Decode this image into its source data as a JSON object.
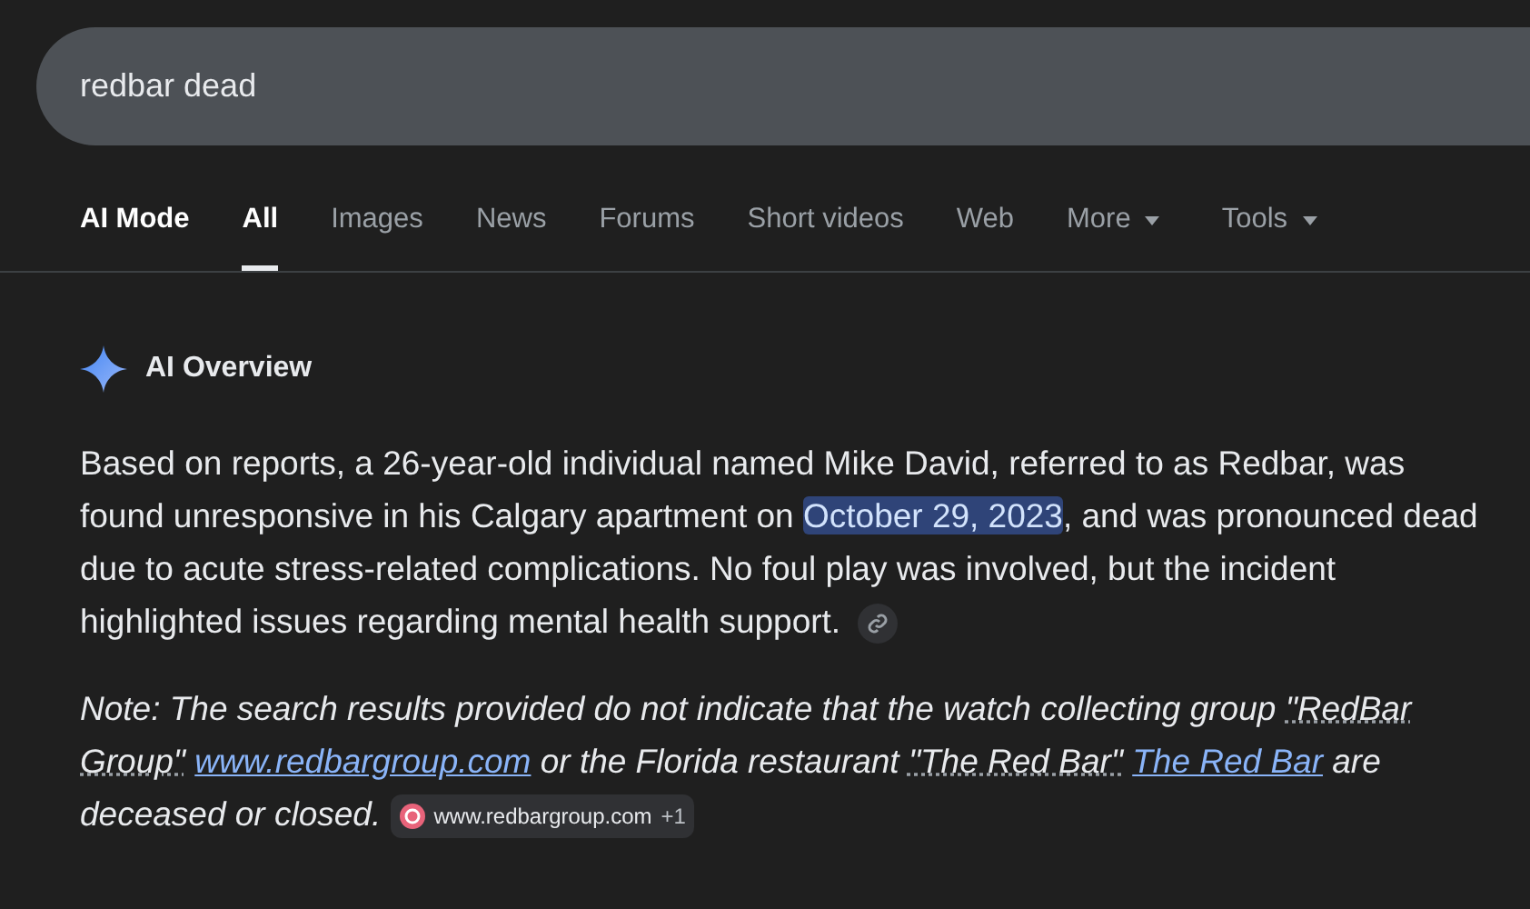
{
  "search": {
    "value": "redbar dead"
  },
  "tabs": [
    {
      "label": "AI Mode",
      "selected": false,
      "kind": "mode"
    },
    {
      "label": "All",
      "selected": true,
      "kind": "tab"
    },
    {
      "label": "Images",
      "selected": false,
      "kind": "tab"
    },
    {
      "label": "News",
      "selected": false,
      "kind": "tab"
    },
    {
      "label": "Forums",
      "selected": false,
      "kind": "tab"
    },
    {
      "label": "Short videos",
      "selected": false,
      "kind": "tab"
    },
    {
      "label": "Web",
      "selected": false,
      "kind": "tab"
    },
    {
      "label": "More",
      "selected": false,
      "kind": "menu"
    },
    {
      "label": "Tools",
      "selected": false,
      "kind": "menu"
    }
  ],
  "overview": {
    "title": "AI Overview",
    "paragraph": [
      {
        "text": "Based on reports, a 26-year-old individual named Mike David, referred to as Redbar, was found unresponsive in his Calgary apartment on ",
        "highlighted": false
      },
      {
        "text": "October 29, 2023",
        "highlighted": true
      },
      {
        "text": ", and was pronounced dead due to acute stress-related complications. No foul play was involved, but the incident highlighted issues regarding mental health support.",
        "highlighted": false
      }
    ],
    "note": [
      {
        "kind": "text",
        "text": "Note: The search results provided do not indicate that the watch collecting group "
      },
      {
        "kind": "term",
        "text": "\"RedBar Group\""
      },
      {
        "kind": "link",
        "text": "www.redbargroup.com"
      },
      {
        "kind": "text",
        "text": " or the Florida restaurant "
      },
      {
        "kind": "term",
        "text": "\"The Red Bar\""
      },
      {
        "kind": "link",
        "text": "The Red Bar"
      },
      {
        "kind": "text",
        "text": " are deceased or closed."
      }
    ],
    "source_chip": {
      "site": "www.redbargroup.com",
      "more": "+1"
    }
  }
}
